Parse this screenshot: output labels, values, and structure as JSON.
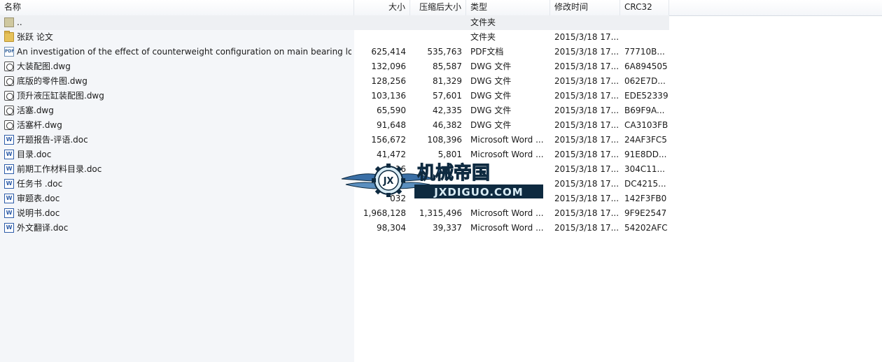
{
  "columns": {
    "name": "名称",
    "size": "大小",
    "packed": "压缩后大小",
    "type": "类型",
    "modified": "修改时间",
    "crc": "CRC32"
  },
  "rows": [
    {
      "name": "..",
      "size": "",
      "packed": "",
      "type": "文件夹",
      "modified": "",
      "crc": "",
      "icon": "parent-folder-icon"
    },
    {
      "name": "张跃 论文",
      "size": "",
      "packed": "",
      "type": "文件夹",
      "modified": "2015/3/18 17...",
      "crc": "",
      "icon": "folder-icon"
    },
    {
      "name": "An investigation of the effect of counterweight configuration on main bearing lo...",
      "size": "625,414",
      "packed": "535,763",
      "type": "PDF文档",
      "modified": "2015/3/18 17...",
      "crc": "77710B...",
      "icon": "pdf-file-icon"
    },
    {
      "name": "大装配图.dwg",
      "size": "132,096",
      "packed": "85,587",
      "type": "DWG 文件",
      "modified": "2015/3/18 17...",
      "crc": "6A894505",
      "icon": "dwg-file-icon"
    },
    {
      "name": "底版的零件图.dwg",
      "size": "128,256",
      "packed": "81,329",
      "type": "DWG 文件",
      "modified": "2015/3/18 17...",
      "crc": "062E7D...",
      "icon": "dwg-file-icon"
    },
    {
      "name": "顶升液压缸装配图.dwg",
      "size": "103,136",
      "packed": "57,601",
      "type": "DWG 文件",
      "modified": "2015/3/18 17...",
      "crc": "EDE52339",
      "icon": "dwg-file-icon"
    },
    {
      "name": "活塞.dwg",
      "size": "65,590",
      "packed": "42,335",
      "type": "DWG 文件",
      "modified": "2015/3/18 17...",
      "crc": "B69F9A...",
      "icon": "dwg-file-icon"
    },
    {
      "name": "活塞杆.dwg",
      "size": "91,648",
      "packed": "46,382",
      "type": "DWG 文件",
      "modified": "2015/3/18 17...",
      "crc": "CA3103FB",
      "icon": "dwg-file-icon"
    },
    {
      "name": "开题报告-评语.doc",
      "size": "156,672",
      "packed": "108,396",
      "type": "Microsoft Word ...",
      "modified": "2015/3/18 17...",
      "crc": "24AF3FC5",
      "icon": "word-doc-icon"
    },
    {
      "name": "目录.doc",
      "size": "41,472",
      "packed": "5,801",
      "type": "Microsoft Word ...",
      "modified": "2015/3/18 17...",
      "crc": "91E8DD...",
      "icon": "word-doc-icon"
    },
    {
      "name": "前期工作材料目录.doc",
      "size": "16",
      "packed": "",
      "type": "",
      "modified": "2015/3/18 17...",
      "crc": "304C11...",
      "icon": "word-doc-icon"
    },
    {
      "name": "任务书 .doc",
      "size": "",
      "packed": "",
      "type": "",
      "modified": "2015/3/18 17...",
      "crc": "DC4215...",
      "icon": "word-doc-icon"
    },
    {
      "name": "审题表.doc",
      "size": "032",
      "packed": "",
      "type": "",
      "modified": "2015/3/18 17...",
      "crc": "142F3FB0",
      "icon": "word-doc-icon"
    },
    {
      "name": "说明书.doc",
      "size": "1,968,128",
      "packed": "1,315,496",
      "type": "Microsoft Word ...",
      "modified": "2015/3/18 17...",
      "crc": "9F9E2547",
      "icon": "word-doc-icon"
    },
    {
      "name": "外文翻译.doc",
      "size": "98,304",
      "packed": "39,337",
      "type": "Microsoft Word ...",
      "modified": "2015/3/18 17...",
      "crc": "54202AFC",
      "icon": "word-doc-icon"
    }
  ],
  "watermark": {
    "badge": "JX",
    "title": "机械帝国",
    "site": "JXDIGUO.COM"
  },
  "colors": {
    "watermark_fill": "#3a6fa6",
    "watermark_light": "#d9ecf5",
    "watermark_dark": "#0e2a40"
  }
}
